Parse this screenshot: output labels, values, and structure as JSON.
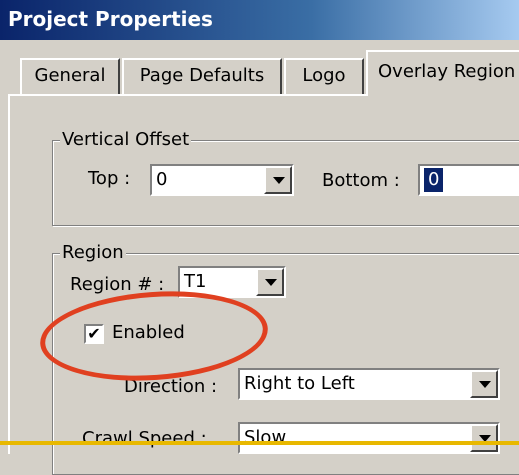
{
  "window": {
    "title": "Project Properties"
  },
  "tabs": [
    {
      "label": "General"
    },
    {
      "label": "Page Defaults"
    },
    {
      "label": "Logo"
    },
    {
      "label": "Overlay Region"
    }
  ],
  "vertical_offset": {
    "legend": "Vertical Offset",
    "top_label": "Top :",
    "top_value": "0",
    "bottom_label": "Bottom :",
    "bottom_value": "0"
  },
  "region": {
    "legend": "Region",
    "region_label": "Region # :",
    "region_value": "T1",
    "enabled_label": "Enabled",
    "enabled_mark": "✔",
    "direction_label": "Direction :",
    "direction_value": "Right to Left",
    "crawl_speed_label": "Crawl Speed :",
    "crawl_speed_value": "Slow"
  },
  "annotation": {
    "color": "#e04020"
  }
}
